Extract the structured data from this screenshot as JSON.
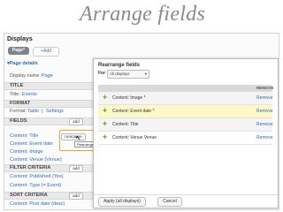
{
  "slide": {
    "title": "Arrange fields"
  },
  "left": {
    "displays_title": "Displays",
    "page_tab": "Page*",
    "add_button": "+Add",
    "page_details": "▾Page details",
    "display_name_label": "Display name:",
    "display_name_value": "Page",
    "title_head": "TITLE",
    "title_label": "Title:",
    "title_value": "Events",
    "format_head": "FORMAT",
    "format_label": "Format:",
    "format_value": "Table",
    "format_sep": "|",
    "settings_link": "Settings",
    "fields_head": "FIELDS",
    "fields_add": "add",
    "fields_items": [
      "Content: Title",
      "Content: Event date",
      "Content: Image",
      "Content: Venue (Venue)"
    ],
    "rearrange_btn": "rearrange",
    "rearrange_tip": "Rearrange",
    "filter_head": "FILTER CRITERIA",
    "filter_add": "add",
    "filter_items": [
      "Content: Published (Yes)",
      "Content: Type (= Event)"
    ],
    "sort_head": "SORT CRITERIA",
    "sort_add": "add",
    "sort_items": [
      "Content: Post date (desc)"
    ]
  },
  "modal": {
    "title": "Rearrange fields",
    "for_label": "For",
    "for_value": "All displays",
    "remove_header": "REMOVE",
    "rows": [
      {
        "label": "Content: Image *",
        "remove": "Remove"
      },
      {
        "label": "Content: Event date *",
        "remove": "Remove"
      },
      {
        "label": "Content: Title",
        "remove": "Remove"
      },
      {
        "label": "Content: Venue Venue",
        "remove": "Remove"
      }
    ],
    "apply_button": "Apply (all displays)",
    "cancel_button": "Cancel"
  },
  "colors": {
    "highlight": "#f0a23a",
    "row_highlight": "#fdf8c8",
    "link": "#2a6ebd"
  },
  "icons": {
    "drag_handle": "move-cross-icon",
    "cursor": "mouse-pointer-icon"
  }
}
